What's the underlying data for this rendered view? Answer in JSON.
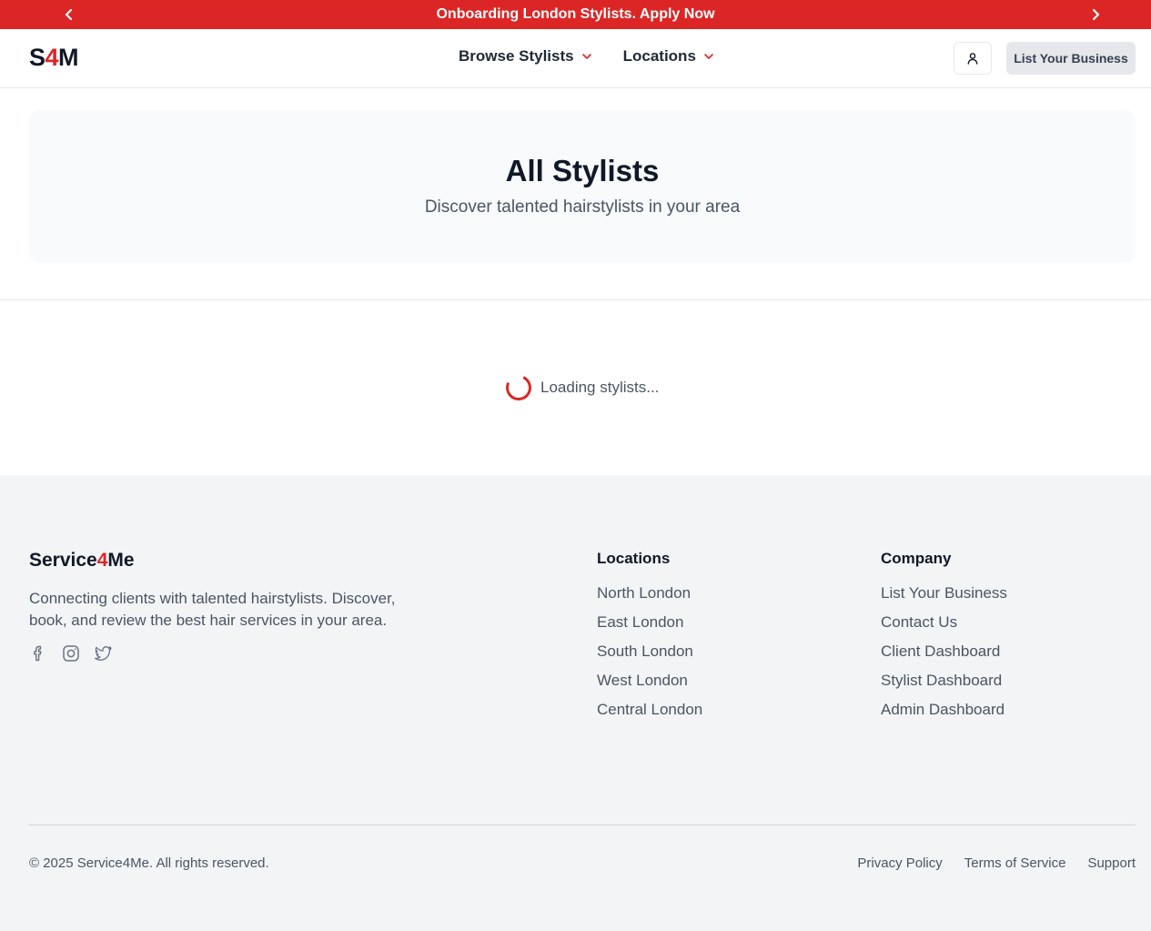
{
  "announcement": {
    "text": "Onboarding London Stylists. Apply Now"
  },
  "header": {
    "logo_s": "S",
    "logo_4": "4",
    "logo_m": "M",
    "nav": [
      {
        "label": "Browse Stylists"
      },
      {
        "label": "Locations"
      }
    ],
    "cta": "List Your Business"
  },
  "hero": {
    "title": "All Stylists",
    "subtitle": "Discover talented hairstylists in your area"
  },
  "loading": {
    "text": "Loading stylists..."
  },
  "footer": {
    "brand_a": "Service",
    "brand_b": "4",
    "brand_c": "Me",
    "description": "Connecting clients with talented hairstylists. Discover, book, and review the best hair services in your area.",
    "social_icons": [
      "facebook-icon",
      "instagram-icon",
      "twitter-icon"
    ],
    "locations": {
      "title": "Locations",
      "links": [
        "North London",
        "East London",
        "South London",
        "West London",
        "Central London"
      ]
    },
    "company": {
      "title": "Company",
      "links": [
        "List Your Business",
        "Contact Us",
        "Client Dashboard",
        "Stylist Dashboard",
        "Admin Dashboard"
      ]
    },
    "copyright": "© 2025 Service4Me. All rights reserved.",
    "legal": [
      "Privacy Policy",
      "Terms of Service",
      "Support"
    ]
  },
  "colors": {
    "accent": "#dc2626",
    "footer_bg": "#f3f4f6",
    "hero_bg": "#f8fafc"
  }
}
